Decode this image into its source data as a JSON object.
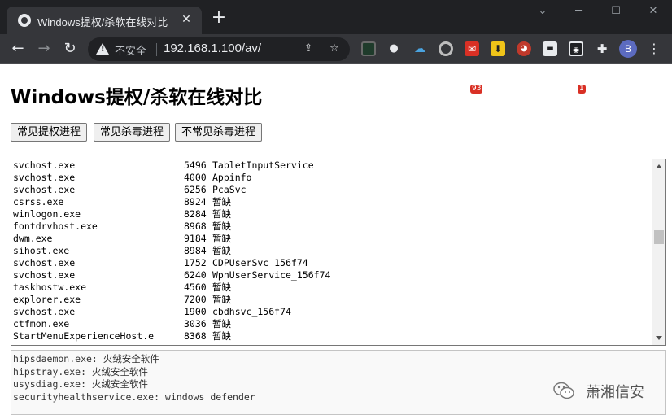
{
  "browser": {
    "tab_title": "Windows提权/杀软在线对比",
    "security_label": "不安全",
    "url": "192.168.1.100/av/",
    "extension_badges": {
      "mail": "93",
      "ghost": "1"
    },
    "profile_initial": "B",
    "icons": [
      "globe-icon",
      "close-icon",
      "plus-icon",
      "minimize-icon",
      "maximize-icon",
      "window-close-icon",
      "back-icon",
      "forward-icon",
      "reload-icon",
      "warning-icon",
      "share-icon",
      "star-icon",
      "puzzle-icon",
      "kebab-menu-icon"
    ]
  },
  "page": {
    "title": "Windows提权/杀软在线对比",
    "buttons": [
      "常见提权进程",
      "常见杀毒进程",
      "不常见杀毒进程"
    ]
  },
  "process_list": [
    {
      "name": "svchost.exe",
      "pid": "5496",
      "service": "TabletInputService"
    },
    {
      "name": "svchost.exe",
      "pid": "4000",
      "service": "Appinfo"
    },
    {
      "name": "svchost.exe",
      "pid": "6256",
      "service": "PcaSvc"
    },
    {
      "name": "csrss.exe",
      "pid": "8924",
      "service": "暂缺"
    },
    {
      "name": "winlogon.exe",
      "pid": "8284",
      "service": "暂缺"
    },
    {
      "name": "fontdrvhost.exe",
      "pid": "8968",
      "service": "暂缺"
    },
    {
      "name": "dwm.exe",
      "pid": "9184",
      "service": "暂缺"
    },
    {
      "name": "sihost.exe",
      "pid": "8984",
      "service": "暂缺"
    },
    {
      "name": "svchost.exe",
      "pid": "1752",
      "service": "CDPUserSvc_156f74"
    },
    {
      "name": "svchost.exe",
      "pid": "6240",
      "service": "WpnUserService_156f74"
    },
    {
      "name": "taskhostw.exe",
      "pid": "4560",
      "service": "暂缺"
    },
    {
      "name": "explorer.exe",
      "pid": "7200",
      "service": "暂缺"
    },
    {
      "name": "svchost.exe",
      "pid": "1900",
      "service": "cbdhsvc_156f74"
    },
    {
      "name": "ctfmon.exe",
      "pid": "3036",
      "service": "暂缺"
    },
    {
      "name": "StartMenuExperienceHost.e",
      "pid": "8368",
      "service": "暂缺"
    }
  ],
  "av_results": [
    "hipsdaemon.exe: 火绒安全软件",
    "hipstray.exe: 火绒安全软件",
    "usysdiag.exe: 火绒安全软件",
    "securityhealthservice.exe: windows defender"
  ],
  "watermark": "萧湘信安"
}
